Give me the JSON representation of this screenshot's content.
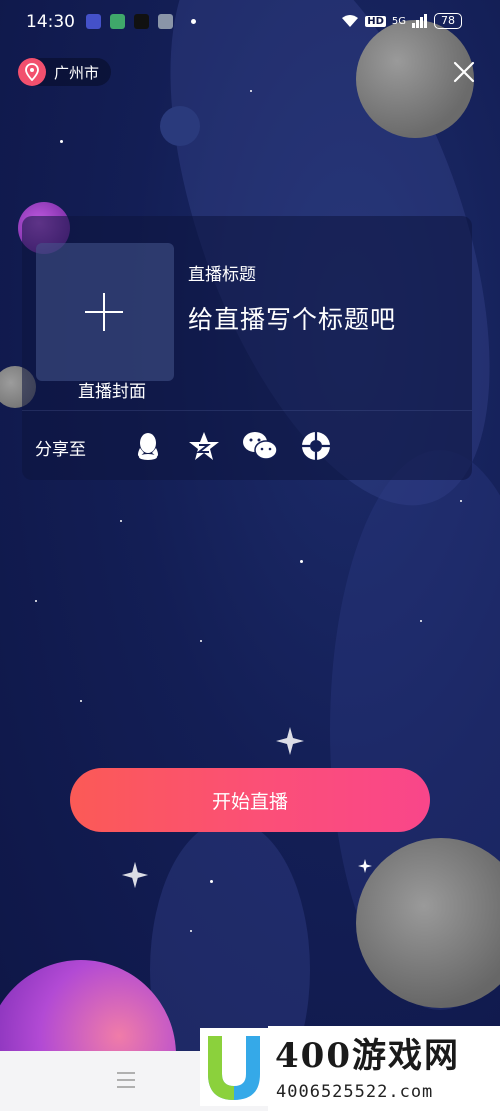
{
  "status_bar": {
    "time": "14:30",
    "network": "HD",
    "signal_label": "5G",
    "battery": "78"
  },
  "header": {
    "location": "广州市"
  },
  "form": {
    "cover_label": "直播封面",
    "title_label": "直播标题",
    "title_placeholder": "给直播写个标题吧",
    "share_label": "分享至",
    "share_targets": [
      "qq-icon",
      "qzone-icon",
      "wechat-icon",
      "moments-icon"
    ]
  },
  "start_button_label": "开始直播",
  "watermark": {
    "main": "400游戏网",
    "sub": "4006525522.com"
  },
  "colors": {
    "accent_start": "#fb5a56",
    "accent_end": "#f9468a",
    "location_pin": "#f2506e"
  }
}
